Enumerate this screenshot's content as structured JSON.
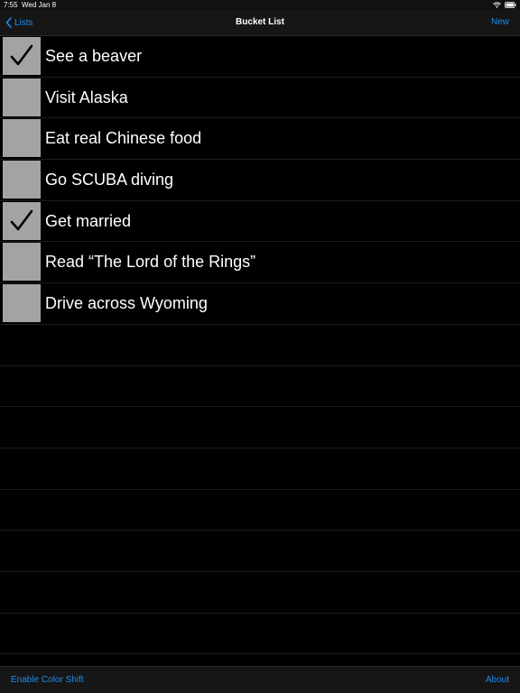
{
  "status_bar": {
    "time": "7:55",
    "date": "Wed Jan 8"
  },
  "nav": {
    "back_label": "Lists",
    "title": "Bucket List",
    "new_label": "New"
  },
  "items": [
    {
      "label": "See a beaver",
      "checked": true
    },
    {
      "label": "Visit Alaska",
      "checked": false
    },
    {
      "label": "Eat real Chinese food",
      "checked": false
    },
    {
      "label": "Go SCUBA diving",
      "checked": false
    },
    {
      "label": "Get married",
      "checked": true
    },
    {
      "label": "Read “The Lord of the Rings”",
      "checked": false
    },
    {
      "label": "Drive across Wyoming",
      "checked": false
    }
  ],
  "toolbar": {
    "color_shift_label": "Enable Color Shift",
    "about_label": "About"
  },
  "colors": {
    "accent": "#1e8cf0",
    "checkbox": "#a3a3a3",
    "background": "#000000"
  },
  "icons": {
    "back": "chevron-left-icon",
    "check": "checkmark-icon",
    "wifi": "wifi-icon",
    "battery": "battery-icon"
  }
}
